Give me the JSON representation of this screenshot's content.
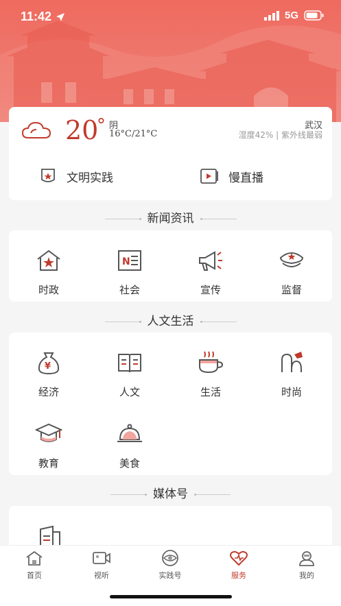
{
  "status_bar": {
    "time": "11:42",
    "network": "5G"
  },
  "weather": {
    "temperature": "20",
    "degree_symbol": "°",
    "condition": "阴",
    "range": "16°C/21°C",
    "city": "武汉",
    "details": "湿度42% | 紫外线最弱"
  },
  "quick_links": [
    {
      "label": "文明实践",
      "icon": "civilization-practice-icon"
    },
    {
      "label": "慢直播",
      "icon": "slow-live-icon"
    }
  ],
  "sections": {
    "news": {
      "title": "新闻资讯",
      "items": [
        {
          "label": "时政",
          "icon": "politics-icon"
        },
        {
          "label": "社会",
          "icon": "society-icon"
        },
        {
          "label": "宣传",
          "icon": "megaphone-icon"
        },
        {
          "label": "监督",
          "icon": "police-cap-icon"
        }
      ]
    },
    "life": {
      "title": "人文生活",
      "items": [
        {
          "label": "经济",
          "icon": "money-bag-icon"
        },
        {
          "label": "人文",
          "icon": "book-icon"
        },
        {
          "label": "生活",
          "icon": "coffee-cup-icon"
        },
        {
          "label": "时尚",
          "icon": "fashion-icon"
        },
        {
          "label": "教育",
          "icon": "graduation-cap-icon"
        },
        {
          "label": "美食",
          "icon": "food-cloche-icon"
        }
      ]
    },
    "media": {
      "title": "媒体号"
    }
  },
  "tabbar": {
    "items": [
      {
        "label": "首页",
        "icon": "home-icon"
      },
      {
        "label": "视听",
        "icon": "video-icon"
      },
      {
        "label": "实践号",
        "icon": "eye-icon"
      },
      {
        "label": "服务",
        "icon": "heart-icon"
      },
      {
        "label": "我的",
        "icon": "profile-icon"
      }
    ],
    "active": "服务"
  },
  "colors": {
    "accent": "#c0392b",
    "hero": "#ef6a5f"
  }
}
